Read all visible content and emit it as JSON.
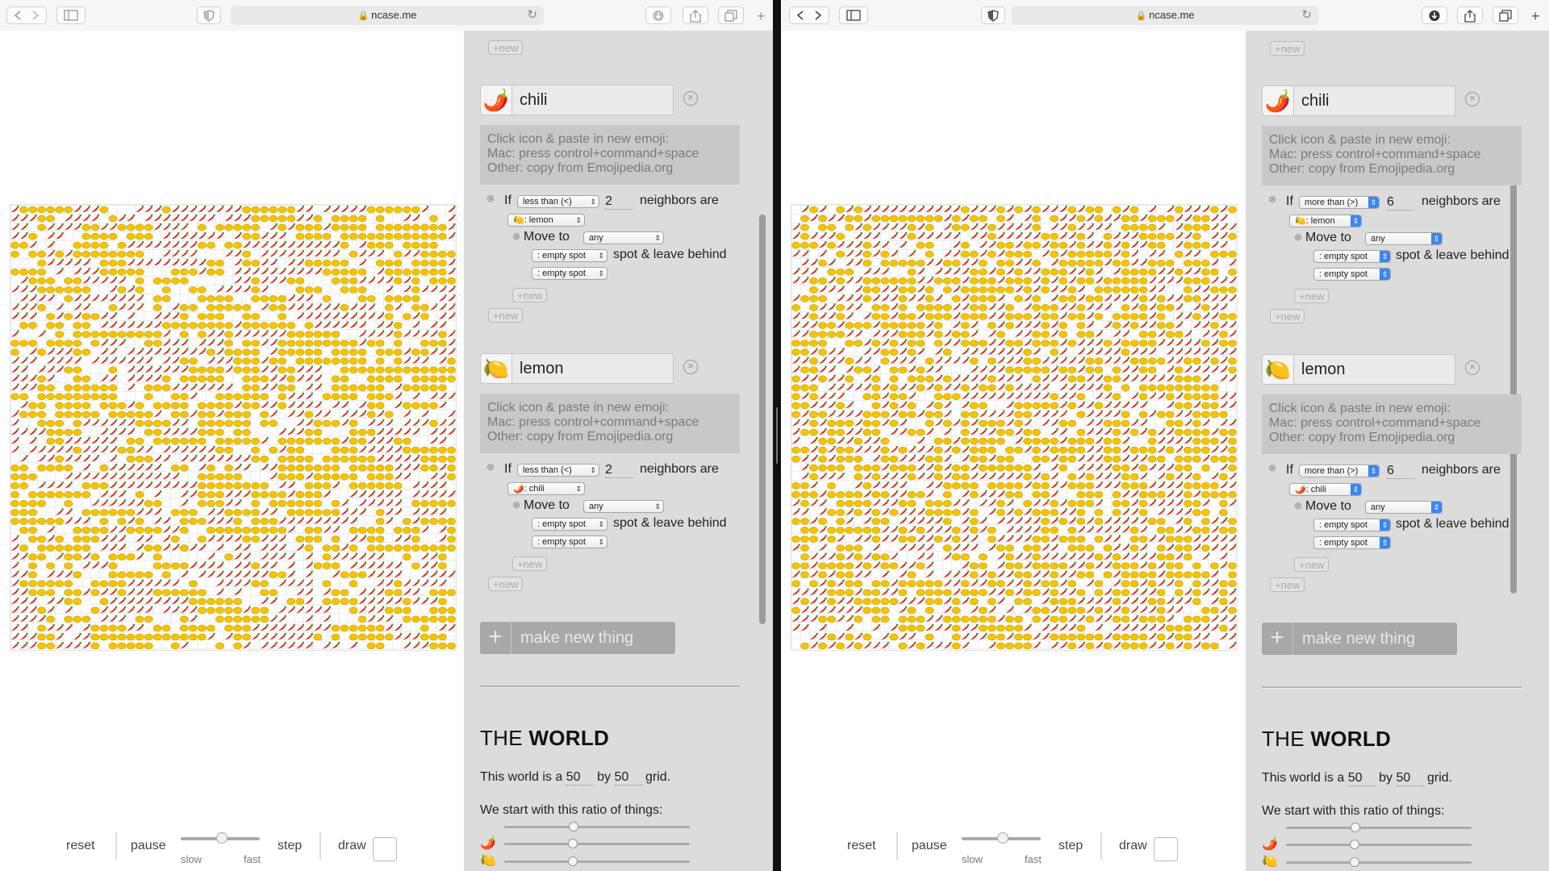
{
  "browser": {
    "url": "ncase.me",
    "lock": "🔒",
    "reload": "↻",
    "new_tab": "+"
  },
  "colors": {
    "chili": "#d8281b",
    "lemon": "#f2c500",
    "panel_bg": "#dcdcdc",
    "select_blue": "#3b87f0"
  },
  "controls": {
    "reset": "reset",
    "pause": "pause",
    "slow": "slow",
    "fast": "fast",
    "step": "step",
    "draw": "draw"
  },
  "new_label": "+new",
  "make_new_thing": "make new thing",
  "hint_lines": [
    "Click icon & paste in new emoji:",
    "Mac: press control+command+space",
    "Other: copy from Emojipedia.org"
  ],
  "rule_text": {
    "if": "If",
    "neighbors_are": "neighbors are",
    "move_to": "Move to",
    "spot_leave": "spot & leave behind"
  },
  "world": {
    "heading_plain": "THE ",
    "heading_bold": "WORLD",
    "size_prefix": "This world is a",
    "width": "50",
    "by": "by",
    "height": "50",
    "size_suffix": "grid.",
    "ratio_label": "We start with this ratio of things:"
  },
  "left": {
    "things": [
      {
        "icon": "🌶️",
        "name": "chili",
        "cmp": "less than (<)",
        "num": "2",
        "neighbor": "🍋: lemon",
        "move": "any",
        "spot": ": empty spot",
        "leave": ": empty spot"
      },
      {
        "icon": "🍋",
        "name": "lemon",
        "cmp": "less than (<)",
        "num": "2",
        "neighbor": "🌶️: chili",
        "move": "any",
        "spot": ": empty spot",
        "leave": ": empty spot"
      }
    ]
  },
  "right": {
    "things": [
      {
        "icon": "🌶️",
        "name": "chili",
        "cmp": "more than (>)",
        "num": "6",
        "neighbor": "🍋: lemon",
        "move": "any",
        "spot": ": empty spot",
        "leave": ": empty spot"
      },
      {
        "icon": "🍋",
        "name": "lemon",
        "cmp": "more than (>)",
        "num": "6",
        "neighbor": "🌶️: chili",
        "move": "any",
        "spot": ": empty spot",
        "leave": ": empty spot"
      }
    ]
  },
  "ratio_icons": [
    "🌶️",
    "🍋"
  ]
}
